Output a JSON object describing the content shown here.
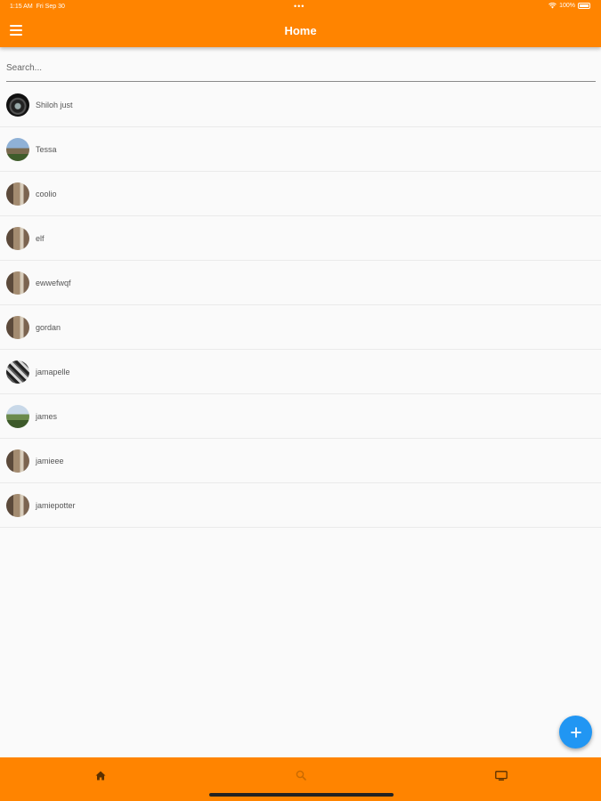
{
  "status_bar": {
    "time": "1:15 AM",
    "date": "Fri Sep 30",
    "battery": "100%",
    "icons": [
      "wifi-icon",
      "battery-icon"
    ]
  },
  "header": {
    "title": "Home",
    "menu_icon": "hamburger-menu-icon",
    "background_color": "#ff8400"
  },
  "search": {
    "placeholder": "Search..."
  },
  "contacts": [
    {
      "name": "Shiloh just",
      "avatar": "dark-swirl-image"
    },
    {
      "name": "Tessa",
      "avatar": "landscape-image"
    },
    {
      "name": "coolio",
      "avatar": "doorway-image"
    },
    {
      "name": "elf",
      "avatar": "doorway-image"
    },
    {
      "name": "ewwefwqf",
      "avatar": "doorway-image"
    },
    {
      "name": "gordan",
      "avatar": "doorway-image"
    },
    {
      "name": "jamapelle",
      "avatar": "striped-image"
    },
    {
      "name": "james",
      "avatar": "landscape-image"
    },
    {
      "name": "jamieee",
      "avatar": "doorway-image"
    },
    {
      "name": "jamiepotter",
      "avatar": "doorway-image"
    }
  ],
  "fab": {
    "icon": "plus-icon",
    "color": "#2196f3"
  },
  "bottom_nav": {
    "items": [
      {
        "icon": "home-icon"
      },
      {
        "icon": "search-icon"
      },
      {
        "icon": "tv-icon"
      }
    ],
    "background_color": "#ff8400"
  }
}
